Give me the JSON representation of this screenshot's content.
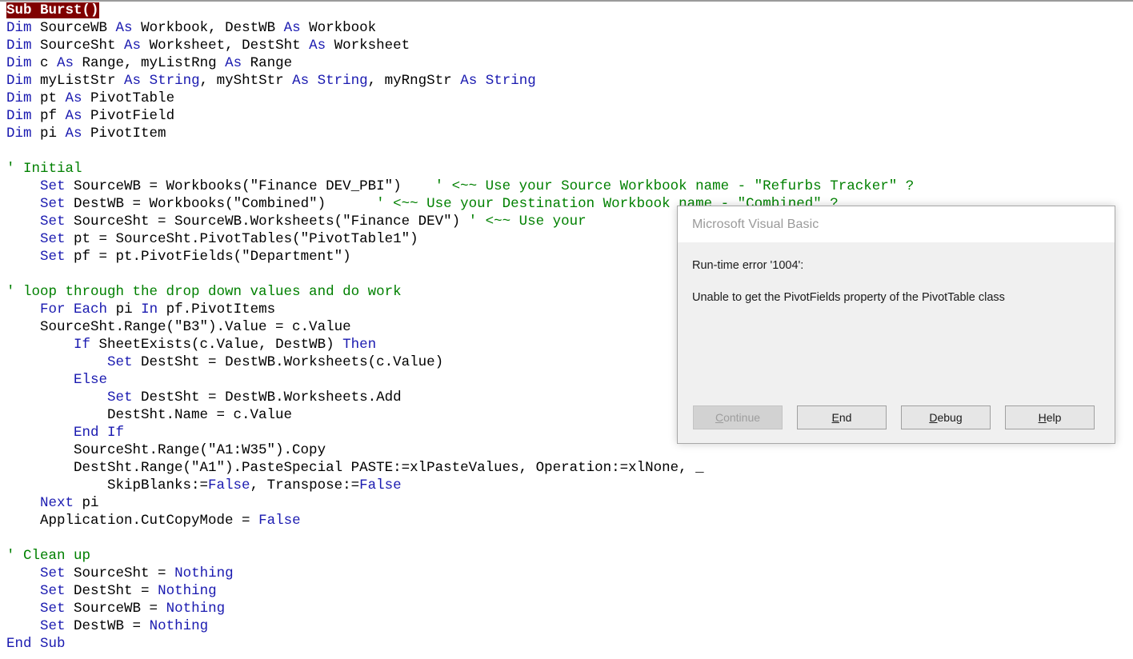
{
  "editor": {
    "name": "vba-code-editor",
    "colors": {
      "keyword": "#1a1ab0",
      "comment": "#008000",
      "plain": "#000000",
      "selection_bg": "#800000",
      "selection_fg": "#ffffff",
      "background": "#ffffff"
    },
    "lines": [
      [
        {
          "t": "Sub Burst()",
          "c": "sel"
        }
      ],
      [
        {
          "t": "Dim",
          "c": "kw"
        },
        {
          "t": " SourceWB ",
          "c": "plain"
        },
        {
          "t": "As",
          "c": "kw"
        },
        {
          "t": " Workbook, DestWB ",
          "c": "plain"
        },
        {
          "t": "As",
          "c": "kw"
        },
        {
          "t": " Workbook",
          "c": "plain"
        }
      ],
      [
        {
          "t": "Dim",
          "c": "kw"
        },
        {
          "t": " SourceSht ",
          "c": "plain"
        },
        {
          "t": "As",
          "c": "kw"
        },
        {
          "t": " Worksheet, DestSht ",
          "c": "plain"
        },
        {
          "t": "As",
          "c": "kw"
        },
        {
          "t": " Worksheet",
          "c": "plain"
        }
      ],
      [
        {
          "t": "Dim",
          "c": "kw"
        },
        {
          "t": " c ",
          "c": "plain"
        },
        {
          "t": "As",
          "c": "kw"
        },
        {
          "t": " Range, myListRng ",
          "c": "plain"
        },
        {
          "t": "As",
          "c": "kw"
        },
        {
          "t": " Range",
          "c": "plain"
        }
      ],
      [
        {
          "t": "Dim",
          "c": "kw"
        },
        {
          "t": " myListStr ",
          "c": "plain"
        },
        {
          "t": "As",
          "c": "kw"
        },
        {
          "t": " ",
          "c": "plain"
        },
        {
          "t": "String",
          "c": "kw"
        },
        {
          "t": ", myShtStr ",
          "c": "plain"
        },
        {
          "t": "As",
          "c": "kw"
        },
        {
          "t": " ",
          "c": "plain"
        },
        {
          "t": "String",
          "c": "kw"
        },
        {
          "t": ", myRngStr ",
          "c": "plain"
        },
        {
          "t": "As",
          "c": "kw"
        },
        {
          "t": " ",
          "c": "plain"
        },
        {
          "t": "String",
          "c": "kw"
        }
      ],
      [
        {
          "t": "Dim",
          "c": "kw"
        },
        {
          "t": " pt ",
          "c": "plain"
        },
        {
          "t": "As",
          "c": "kw"
        },
        {
          "t": " PivotTable",
          "c": "plain"
        }
      ],
      [
        {
          "t": "Dim",
          "c": "kw"
        },
        {
          "t": " pf ",
          "c": "plain"
        },
        {
          "t": "As",
          "c": "kw"
        },
        {
          "t": " PivotField",
          "c": "plain"
        }
      ],
      [
        {
          "t": "Dim",
          "c": "kw"
        },
        {
          "t": " pi ",
          "c": "plain"
        },
        {
          "t": "As",
          "c": "kw"
        },
        {
          "t": " PivotItem",
          "c": "plain"
        }
      ],
      [],
      [
        {
          "t": "' Initial",
          "c": "com"
        }
      ],
      [
        {
          "t": "    ",
          "c": "plain"
        },
        {
          "t": "Set",
          "c": "kw"
        },
        {
          "t": " SourceWB = Workbooks(\"Finance DEV_PBI\")    ",
          "c": "plain"
        },
        {
          "t": "' <~~ Use your Source Workbook name - \"Refurbs Tracker\" ?",
          "c": "com"
        }
      ],
      [
        {
          "t": "    ",
          "c": "plain"
        },
        {
          "t": "Set",
          "c": "kw"
        },
        {
          "t": " DestWB = Workbooks(\"Combined\")      ",
          "c": "plain"
        },
        {
          "t": "' <~~ Use your Destination Workbook name - \"Combined\" ?",
          "c": "com"
        }
      ],
      [
        {
          "t": "    ",
          "c": "plain"
        },
        {
          "t": "Set",
          "c": "kw"
        },
        {
          "t": " SourceSht = SourceWB.Worksheets(\"Finance DEV\") ",
          "c": "plain"
        },
        {
          "t": "' <~~ Use your",
          "c": "com"
        }
      ],
      [
        {
          "t": "    ",
          "c": "plain"
        },
        {
          "t": "Set",
          "c": "kw"
        },
        {
          "t": " pt = SourceSht.PivotTables(\"PivotTable1\")",
          "c": "plain"
        }
      ],
      [
        {
          "t": "    ",
          "c": "plain"
        },
        {
          "t": "Set",
          "c": "kw"
        },
        {
          "t": " pf = pt.PivotFields(\"Department\")",
          "c": "plain"
        }
      ],
      [],
      [
        {
          "t": "' loop through the drop down values and do work",
          "c": "com"
        }
      ],
      [
        {
          "t": "    ",
          "c": "plain"
        },
        {
          "t": "For",
          "c": "kw"
        },
        {
          "t": " ",
          "c": "plain"
        },
        {
          "t": "Each",
          "c": "kw"
        },
        {
          "t": " pi ",
          "c": "plain"
        },
        {
          "t": "In",
          "c": "kw"
        },
        {
          "t": " pf.PivotItems",
          "c": "plain"
        }
      ],
      [
        {
          "t": "    SourceSht.Range(\"B3\").Value = c.Value",
          "c": "plain"
        }
      ],
      [
        {
          "t": "        ",
          "c": "plain"
        },
        {
          "t": "If",
          "c": "kw"
        },
        {
          "t": " SheetExists(c.Value, DestWB) ",
          "c": "plain"
        },
        {
          "t": "Then",
          "c": "kw"
        }
      ],
      [
        {
          "t": "            ",
          "c": "plain"
        },
        {
          "t": "Set",
          "c": "kw"
        },
        {
          "t": " DestSht = DestWB.Worksheets(c.Value)",
          "c": "plain"
        }
      ],
      [
        {
          "t": "        ",
          "c": "plain"
        },
        {
          "t": "Else",
          "c": "kw"
        }
      ],
      [
        {
          "t": "            ",
          "c": "plain"
        },
        {
          "t": "Set",
          "c": "kw"
        },
        {
          "t": " DestSht = DestWB.Worksheets.Add",
          "c": "plain"
        }
      ],
      [
        {
          "t": "            DestSht.Name = c.Value",
          "c": "plain"
        }
      ],
      [
        {
          "t": "        ",
          "c": "plain"
        },
        {
          "t": "End If",
          "c": "kw"
        }
      ],
      [
        {
          "t": "        SourceSht.Range(\"A1:W35\").Copy",
          "c": "plain"
        }
      ],
      [
        {
          "t": "        DestSht.Range(\"A1\").PasteSpecial PASTE:=xlPasteValues, Operation:=xlNone, _",
          "c": "plain"
        }
      ],
      [
        {
          "t": "            SkipBlanks:=",
          "c": "plain"
        },
        {
          "t": "False",
          "c": "kw"
        },
        {
          "t": ", Transpose:=",
          "c": "plain"
        },
        {
          "t": "False",
          "c": "kw"
        }
      ],
      [
        {
          "t": "    ",
          "c": "plain"
        },
        {
          "t": "Next",
          "c": "kw"
        },
        {
          "t": " pi",
          "c": "plain"
        }
      ],
      [
        {
          "t": "    Application.CutCopyMode = ",
          "c": "plain"
        },
        {
          "t": "False",
          "c": "kw"
        }
      ],
      [],
      [
        {
          "t": "' Clean up",
          "c": "com"
        }
      ],
      [
        {
          "t": "    ",
          "c": "plain"
        },
        {
          "t": "Set",
          "c": "kw"
        },
        {
          "t": " SourceSht = ",
          "c": "plain"
        },
        {
          "t": "Nothing",
          "c": "kw"
        }
      ],
      [
        {
          "t": "    ",
          "c": "plain"
        },
        {
          "t": "Set",
          "c": "kw"
        },
        {
          "t": " DestSht = ",
          "c": "plain"
        },
        {
          "t": "Nothing",
          "c": "kw"
        }
      ],
      [
        {
          "t": "    ",
          "c": "plain"
        },
        {
          "t": "Set",
          "c": "kw"
        },
        {
          "t": " SourceWB = ",
          "c": "plain"
        },
        {
          "t": "Nothing",
          "c": "kw"
        }
      ],
      [
        {
          "t": "    ",
          "c": "plain"
        },
        {
          "t": "Set",
          "c": "kw"
        },
        {
          "t": " DestWB = ",
          "c": "plain"
        },
        {
          "t": "Nothing",
          "c": "kw"
        }
      ],
      [
        {
          "t": "End Sub",
          "c": "kw"
        }
      ]
    ]
  },
  "dialog": {
    "title": "Microsoft Visual Basic",
    "message_line1": "Run-time error '1004':",
    "message_line2": "Unable to get the PivotFields property of the PivotTable class",
    "buttons": [
      {
        "label": "Continue",
        "accel": "C",
        "disabled": true,
        "name": "continue-button"
      },
      {
        "label": "End",
        "accel": "E",
        "disabled": false,
        "name": "end-button"
      },
      {
        "label": "Debug",
        "accel": "D",
        "disabled": false,
        "name": "debug-button"
      },
      {
        "label": "Help",
        "accel": "H",
        "disabled": false,
        "name": "help-button"
      }
    ]
  }
}
